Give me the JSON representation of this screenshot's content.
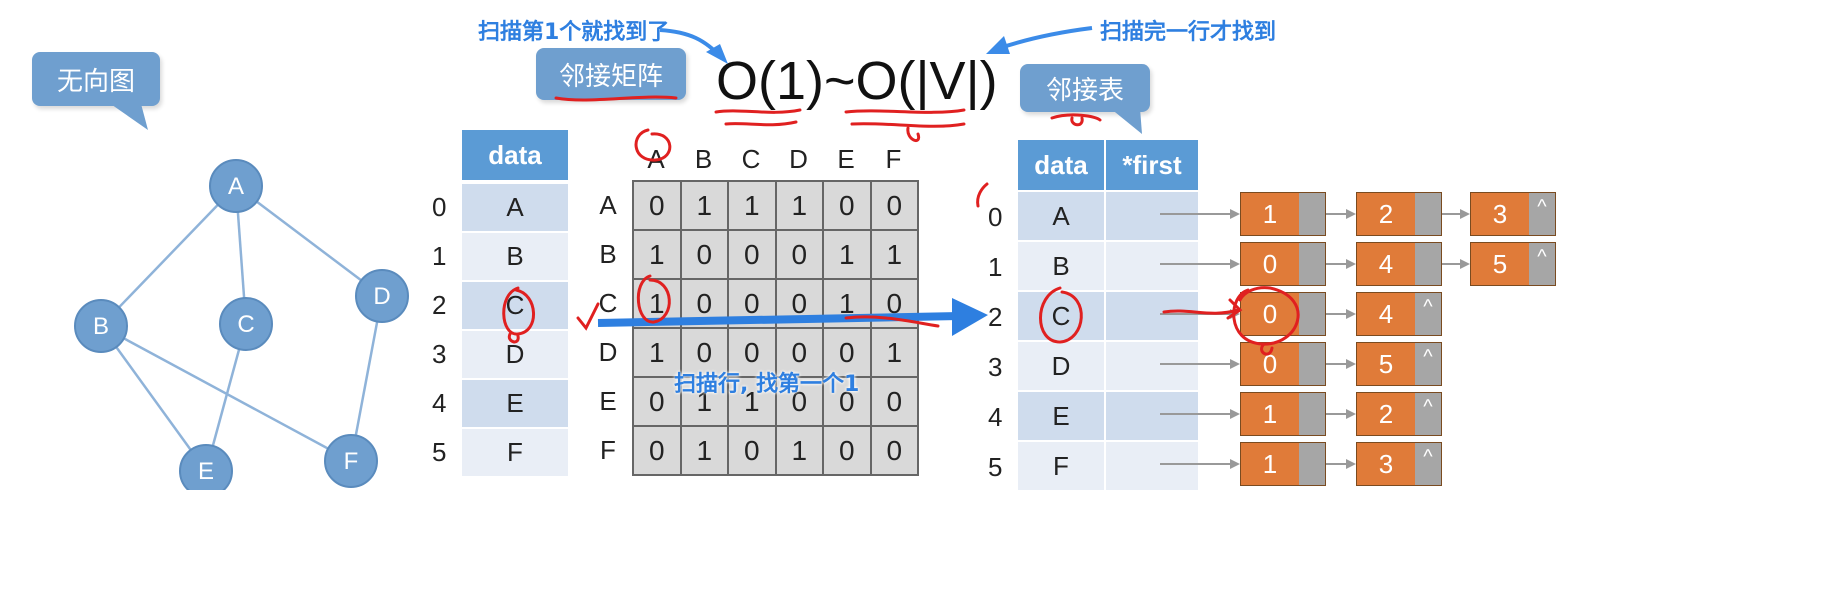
{
  "graph": {
    "callout_label": "无向图",
    "vertices": [
      "A",
      "B",
      "C",
      "D",
      "E",
      "F"
    ],
    "edges": [
      [
        "A",
        "B"
      ],
      [
        "A",
        "C"
      ],
      [
        "A",
        "D"
      ],
      [
        "B",
        "E"
      ],
      [
        "B",
        "F"
      ],
      [
        "C",
        "E"
      ],
      [
        "D",
        "F"
      ]
    ]
  },
  "complexity": {
    "matrix_callout": "邻接矩阵",
    "list_callout": "邻接表",
    "expression": "O(1)~O(|V|)",
    "note_best": "扫描第1个就找到了",
    "note_worst": "扫描完一行才找到",
    "note_scan": "扫描行, 找第一个1"
  },
  "vertex_table": {
    "header": "data",
    "indices": [
      "0",
      "1",
      "2",
      "3",
      "4",
      "5"
    ],
    "values": [
      "A",
      "B",
      "C",
      "D",
      "E",
      "F"
    ]
  },
  "matrix": {
    "col_headers": [
      "A",
      "B",
      "C",
      "D",
      "E",
      "F"
    ],
    "row_headers": [
      "A",
      "B",
      "C",
      "D",
      "E",
      "F"
    ],
    "rows": [
      [
        "0",
        "1",
        "1",
        "1",
        "0",
        "0"
      ],
      [
        "1",
        "0",
        "0",
        "0",
        "1",
        "1"
      ],
      [
        "1",
        "0",
        "0",
        "0",
        "1",
        "0"
      ],
      [
        "1",
        "0",
        "0",
        "0",
        "0",
        "1"
      ],
      [
        "0",
        "1",
        "1",
        "0",
        "0",
        "0"
      ],
      [
        "0",
        "1",
        "0",
        "1",
        "0",
        "0"
      ]
    ]
  },
  "adj_list": {
    "headers": [
      "data",
      "*first"
    ],
    "indices": [
      "0",
      "1",
      "2",
      "3",
      "4",
      "5"
    ],
    "values": [
      "A",
      "B",
      "C",
      "D",
      "E",
      "F"
    ],
    "null_symbol": "^",
    "chains": [
      [
        "1",
        "2",
        "3"
      ],
      [
        "0",
        "4",
        "5"
      ],
      [
        "0",
        "4"
      ],
      [
        "0",
        "5"
      ],
      [
        "1",
        "2"
      ],
      [
        "1",
        "3"
      ]
    ]
  },
  "colors": {
    "accent_blue": "#5b9bd5",
    "node_orange": "#e07b39",
    "annotation_red": "#e02020",
    "note_blue": "#2e7fe0"
  }
}
